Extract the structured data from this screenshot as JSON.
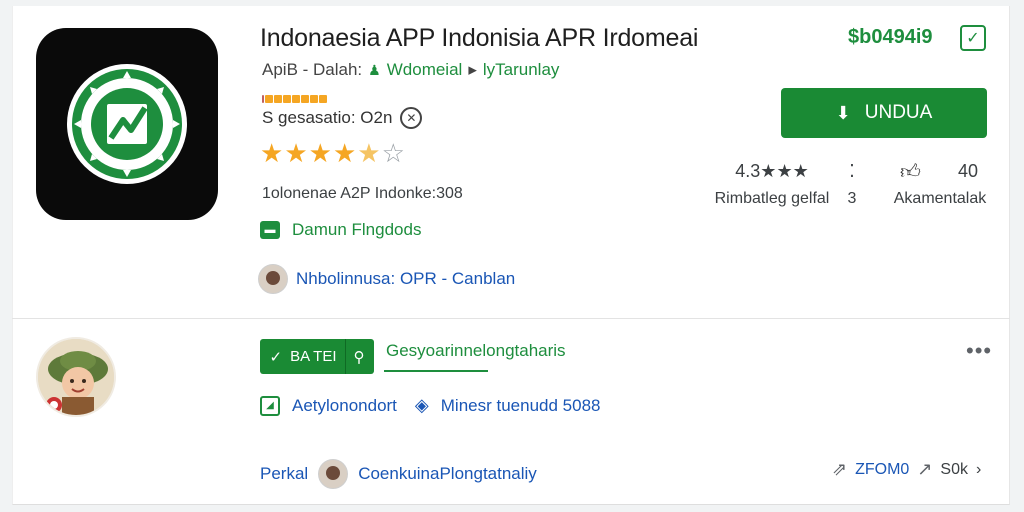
{
  "app": {
    "title": "Indonaesia APP Indonisia APR Irdomeai",
    "price": "$b0494i9",
    "meta_prefix": "ApiB - Dalah:",
    "developer_link": "Wdomeial",
    "meta_suffix": "lyTarunlay",
    "desc_text": "S gesasatio: O2n",
    "sub_info": "1olonenae A2P Indonke:308",
    "green_link": "Damun Flngdods",
    "developer_row": "Nhbolinnusa: OPR - Canblan",
    "install_label": "UNDUA"
  },
  "rating": {
    "stars_full": 4,
    "stars_half": 1,
    "stars_empty": 1
  },
  "stats": {
    "score": "4.3★★★",
    "score_label": "Rimbatleg gelfal",
    "middle_value": "3",
    "count": "40",
    "count_label": "Akamentalak"
  },
  "review": {
    "approve_label": "BA TEI",
    "tab_label": "Gesyoarinnelongtaharis",
    "info_text_1": "Aetylonondort",
    "info_text_2": "Minesr tuenudd 5088",
    "footer_name": "Perkal",
    "footer_text": "CoenkuinaPlongtatnaliy",
    "footer_code": "ZFOM0",
    "footer_more": "S0k"
  },
  "colors": {
    "accent_green": "#1a8a34",
    "link_blue": "#1a56b5",
    "star_gold": "#f5a623"
  },
  "icons": [
    "app-logo-icon",
    "check-square-icon",
    "clock-icon",
    "download-icon",
    "thumbs-up-icon",
    "message-square-icon",
    "diamond-icon",
    "share-arrow-icon",
    "pin-icon"
  ]
}
